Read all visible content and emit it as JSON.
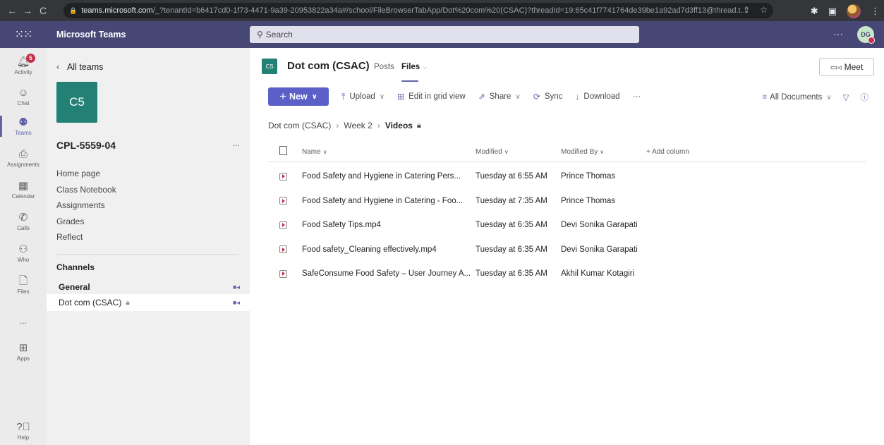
{
  "browser": {
    "url_host": "teams.microsoft.com",
    "url_rest": "/_?tenantId=b6417cd0-1f73-4471-9a39-20953822a34a#/school/FileBrowserTabApp/Dot%20com%20(CSAC)?threadId=19:65c41f7741764de39be1a92ad7d3ff13@thread.t...",
    "back_icon": "←",
    "forward_icon": "→",
    "reload_icon": "C"
  },
  "header": {
    "app_name": "Microsoft Teams",
    "search_placeholder": "Search",
    "avatar_initials": "DG"
  },
  "rail": {
    "activity_badge": "5",
    "items": [
      {
        "label": "Activity"
      },
      {
        "label": "Chat"
      },
      {
        "label": "Teams"
      },
      {
        "label": "Assignments"
      },
      {
        "label": "Calendar"
      },
      {
        "label": "Calls"
      },
      {
        "label": "Who"
      },
      {
        "label": "Files"
      },
      {
        "label": "..."
      },
      {
        "label": "Apps"
      },
      {
        "label": "Help"
      }
    ]
  },
  "team_panel": {
    "back_label": "All teams",
    "tile_initials": "C5",
    "team_name": "CPL-5559-04",
    "more": "...",
    "links": [
      "Home page",
      "Class Notebook",
      "Assignments",
      "Grades",
      "Reflect"
    ],
    "channels_heading": "Channels",
    "channels": [
      {
        "name": "General"
      },
      {
        "name": "Dot com (CSAC)"
      }
    ]
  },
  "main": {
    "channel_tile": "CS",
    "channel_title": "Dot com (CSAC)",
    "tab_posts": "Posts",
    "tab_files": "Files",
    "meet_label": "Meet",
    "toolbar": {
      "new_label": "New",
      "upload_label": "Upload",
      "grid_label": "Edit in grid view",
      "share_label": "Share",
      "sync_label": "Sync",
      "download_label": "Download",
      "more": "···",
      "view_label": "All Documents"
    },
    "breadcrumb": [
      "Dot com (CSAC)",
      "Week 2",
      "Videos"
    ],
    "table": {
      "headers": {
        "name": "Name",
        "modified": "Modified",
        "modified_by": "Modified By",
        "add_column": "+ Add column"
      },
      "rows": [
        {
          "name": "Food Safety and Hygiene in Catering  Pers...",
          "modified": "Tuesday at 6:55 AM",
          "modified_by": "Prince Thomas"
        },
        {
          "name": "Food Safety and Hygiene in Catering - Foo...",
          "modified": "Tuesday at 7:35 AM",
          "modified_by": "Prince Thomas"
        },
        {
          "name": "Food Safety Tips.mp4",
          "modified": "Tuesday at 6:35 AM",
          "modified_by": "Devi Sonika Garapati"
        },
        {
          "name": "Food safety_Cleaning effectively.mp4",
          "modified": "Tuesday at 6:35 AM",
          "modified_by": "Devi Sonika Garapati"
        },
        {
          "name": "SafeConsume Food Safety – User Journey A...",
          "modified": "Tuesday at 6:35 AM",
          "modified_by": "Akhil Kumar Kotagiri"
        }
      ]
    }
  },
  "colors": {
    "teams_header": "#464775",
    "accent": "#6264a7",
    "new_button": "#5b5fc7",
    "team_tile": "#238074",
    "badge": "#c4314b"
  }
}
